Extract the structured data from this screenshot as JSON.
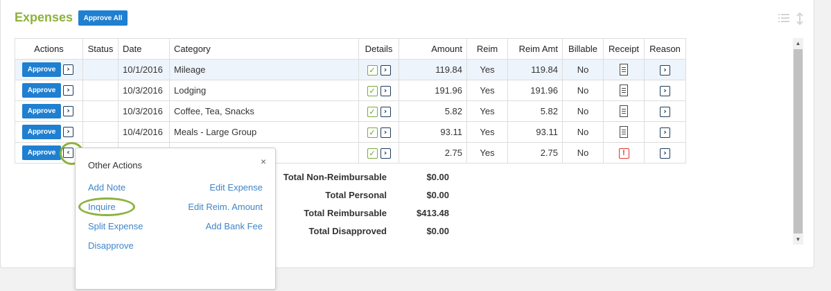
{
  "header": {
    "title": "Expenses",
    "approve_all_label": "Approve All"
  },
  "table": {
    "columns": [
      "Actions",
      "Status",
      "Date",
      "Category",
      "Details",
      "Amount",
      "Reim",
      "Reim Amt",
      "Billable",
      "Receipt",
      "Reason"
    ],
    "approve_label": "Approve",
    "rows": [
      {
        "date": "10/1/2016",
        "category": "Mileage",
        "amount": "119.84",
        "reim": "Yes",
        "reim_amt": "119.84",
        "billable": "No"
      },
      {
        "date": "10/3/2016",
        "category": "Lodging",
        "amount": "191.96",
        "reim": "Yes",
        "reim_amt": "191.96",
        "billable": "No"
      },
      {
        "date": "10/3/2016",
        "category": "Coffee, Tea, Snacks",
        "amount": "5.82",
        "reim": "Yes",
        "reim_amt": "5.82",
        "billable": "No"
      },
      {
        "date": "10/4/2016",
        "category": "Meals - Large Group",
        "amount": "93.11",
        "reim": "Yes",
        "reim_amt": "93.11",
        "billable": "No"
      },
      {
        "date": "",
        "category": "",
        "amount": "2.75",
        "reim": "Yes",
        "reim_amt": "2.75",
        "billable": "No"
      }
    ]
  },
  "totals": [
    {
      "label": "Total Non-Reimbursable",
      "value": "$0.00"
    },
    {
      "label": "Total Personal",
      "value": "$0.00"
    },
    {
      "label": "Total Reimbursable",
      "value": "$413.48"
    },
    {
      "label": "Total Disapproved",
      "value": "$0.00"
    }
  ],
  "popup": {
    "title": "Other Actions",
    "close_glyph": "×",
    "add_note": "Add Note",
    "edit_expense": "Edit Expense",
    "inquire": "Inquire",
    "edit_reim_amount": "Edit Reim. Amount",
    "split_expense": "Split Expense",
    "add_bank_fee": "Add Bank Fee",
    "disapprove": "Disapprove"
  },
  "icons": {
    "expand_arrow": "›",
    "collapse_arrow": "‹",
    "check": "✓",
    "warning": "!"
  },
  "colors": {
    "title_green": "#8db23c",
    "button_blue": "#1f7fd0",
    "link_blue": "#3f84c8",
    "warning_red": "#d9342b"
  }
}
